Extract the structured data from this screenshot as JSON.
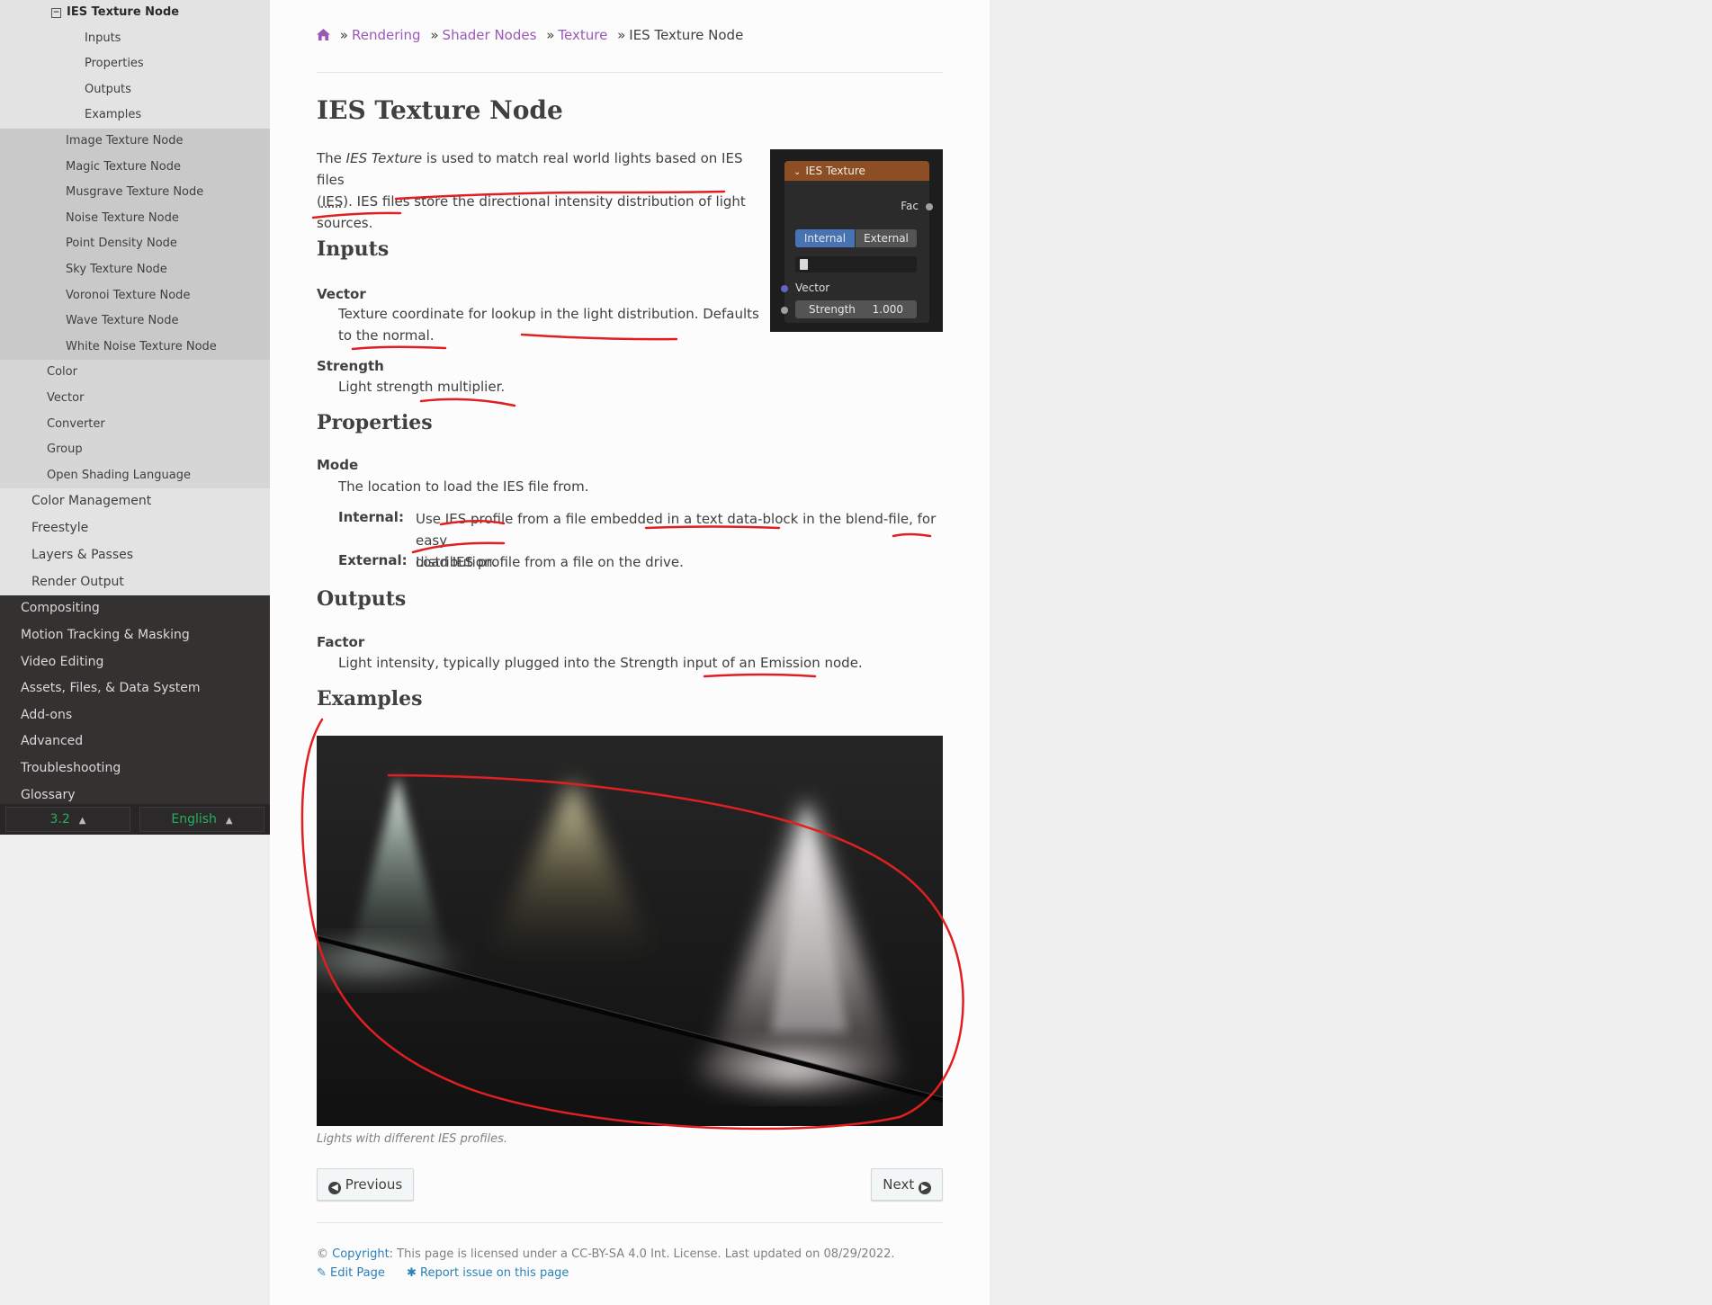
{
  "sidebar": {
    "current": "IES Texture Node",
    "current_subitems": [
      "Inputs",
      "Properties",
      "Outputs",
      "Examples"
    ],
    "texture_items": [
      "Image Texture Node",
      "Magic Texture Node",
      "Musgrave Texture Node",
      "Noise Texture Node",
      "Point Density Node",
      "Sky Texture Node",
      "Voronoi Texture Node",
      "Wave Texture Node",
      "White Noise Texture Node"
    ],
    "shader_items": [
      "Color",
      "Vector",
      "Converter",
      "Group",
      "Open Shading Language"
    ],
    "rendering_items": [
      "Color Management",
      "Freestyle",
      "Layers & Passes",
      "Render Output"
    ],
    "top_items": [
      "Compositing",
      "Motion Tracking & Masking",
      "Video Editing",
      "Assets, Files, & Data System",
      "Add-ons",
      "Advanced",
      "Troubleshooting",
      "Glossary"
    ],
    "version": "3.2",
    "language": "English"
  },
  "breadcrumb": {
    "links": [
      "Rendering",
      "Shader Nodes",
      "Texture"
    ],
    "sep": "»",
    "current": "IES Texture Node"
  },
  "page": {
    "title": "IES Texture Node",
    "intro_pre": "The ",
    "intro_em": "IES Texture",
    "intro_mid": " is used to match real world lights based on IES files",
    "intro_line2a": "(",
    "intro_abbr": "IES",
    "intro_line2b": "). IES files store the directional intensity distribution of light",
    "intro_line3": "sources.",
    "inputs_heading": "Inputs",
    "vector_term": "Vector",
    "vector_desc_1": "Texture coordinate for lookup in the light distribution. Defaults",
    "vector_desc_2": "to the normal.",
    "strength_term": "Strength",
    "strength_desc": "Light strength multiplier.",
    "properties_heading": "Properties",
    "mode_term": "Mode",
    "mode_desc": "The location to load the IES file from.",
    "internal_label": "Internal:",
    "internal_desc_1": "Use IES profile from a file embedded in a text data-block in the blend-file, for easy",
    "internal_desc_2": "distribution.",
    "external_label": "External:",
    "external_desc": "Load IES profile from a file on the drive.",
    "outputs_heading": "Outputs",
    "factor_term": "Factor",
    "factor_desc": "Light intensity, typically plugged into the Strength input of an Emission node.",
    "examples_heading": "Examples",
    "caption": "Lights with different IES profiles."
  },
  "node": {
    "title": "IES Texture",
    "output": "Fac",
    "mode_internal": "Internal",
    "mode_external": "External",
    "input_vector": "Vector",
    "strength_label": "Strength",
    "strength_value": "1.000"
  },
  "nav": {
    "previous": "Previous",
    "next": "Next"
  },
  "footer": {
    "copyright_symbol": "©",
    "copyright_link": "Copyright",
    "license_text": ": This page is licensed under a CC-BY-SA 4.0 Int. License. Last updated on 08/29/2022.",
    "edit_page": "Edit Page",
    "report_issue": "Report issue on this page"
  },
  "colors": {
    "link": "#9b59b6",
    "footer_link": "#2980b9",
    "annotation": "#e02020",
    "version_green": "#27ae60",
    "node_header": "#8c4e22",
    "node_selected": "#4772b3"
  }
}
